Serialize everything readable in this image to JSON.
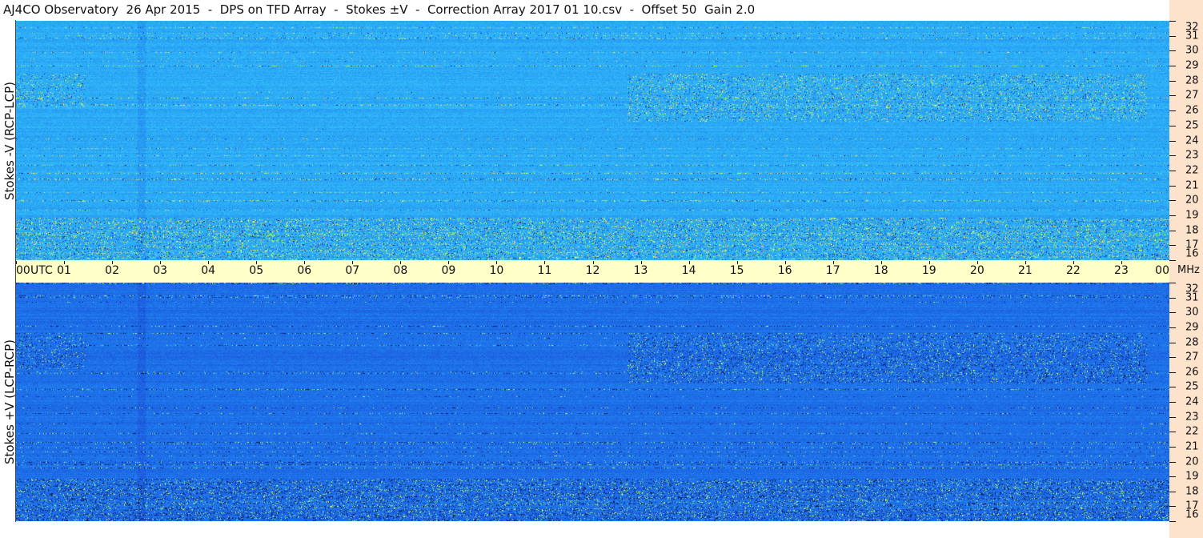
{
  "title": "AJ4CO Observatory  26 Apr 2015  -  DPS on TFD Array  -  Stokes ±V  -  Correction Array 2017 01 10.csv  -  Offset 50  Gain 2.0",
  "chart_data": [
    {
      "type": "heatmap",
      "name": "top-panel",
      "ylabel": "Stokes -V (RCP-LCP)",
      "x_labels": [
        "00",
        "01",
        "02",
        "03",
        "04",
        "05",
        "06",
        "07",
        "08",
        "09",
        "10",
        "11",
        "12",
        "13",
        "14",
        "15",
        "16",
        "17",
        "18",
        "19",
        "20",
        "21",
        "22",
        "23",
        "00"
      ],
      "x_unit": "UTC",
      "y_labels": [
        32,
        31,
        30,
        29,
        28,
        27,
        26,
        25,
        24,
        23,
        22,
        21,
        20,
        19,
        18,
        17,
        16
      ],
      "y_unit": "MHz",
      "ylim": [
        16,
        32
      ],
      "xlim": [
        0,
        24
      ],
      "base_color": "#1f8ef0",
      "colormap": [
        "#000030",
        "#0a2fb0",
        "#1f6fe8",
        "#2aa7f5",
        "#3fd8ff",
        "#a8ff6a",
        "#ffff40",
        "#ff4040"
      ]
    },
    {
      "type": "heatmap",
      "name": "bottom-panel",
      "ylabel": "Stokes +V (LCP-RCP)",
      "x_labels": [
        "00",
        "01",
        "02",
        "03",
        "04",
        "05",
        "06",
        "07",
        "08",
        "09",
        "10",
        "11",
        "12",
        "13",
        "14",
        "15",
        "16",
        "17",
        "18",
        "19",
        "20",
        "21",
        "22",
        "23",
        "00"
      ],
      "x_unit": "UTC",
      "y_labels": [
        32,
        31,
        30,
        29,
        28,
        27,
        26,
        25,
        24,
        23,
        22,
        21,
        20,
        19,
        18,
        17,
        16
      ],
      "y_unit": "MHz",
      "ylim": [
        16,
        32
      ],
      "xlim": [
        0,
        24
      ],
      "base_color": "#1c5ee0",
      "colormap": [
        "#000020",
        "#061a80",
        "#1c4fd8",
        "#1f7fef",
        "#3fc8ff",
        "#a8ff6a",
        "#ffff40",
        "#ff4040"
      ]
    }
  ],
  "axis": {
    "time_unit": "UTC",
    "freq_unit": "MHz"
  },
  "colors": {
    "time_axis_bg": "#ffffc8",
    "freq_axis_bg": "#fde3cc"
  }
}
